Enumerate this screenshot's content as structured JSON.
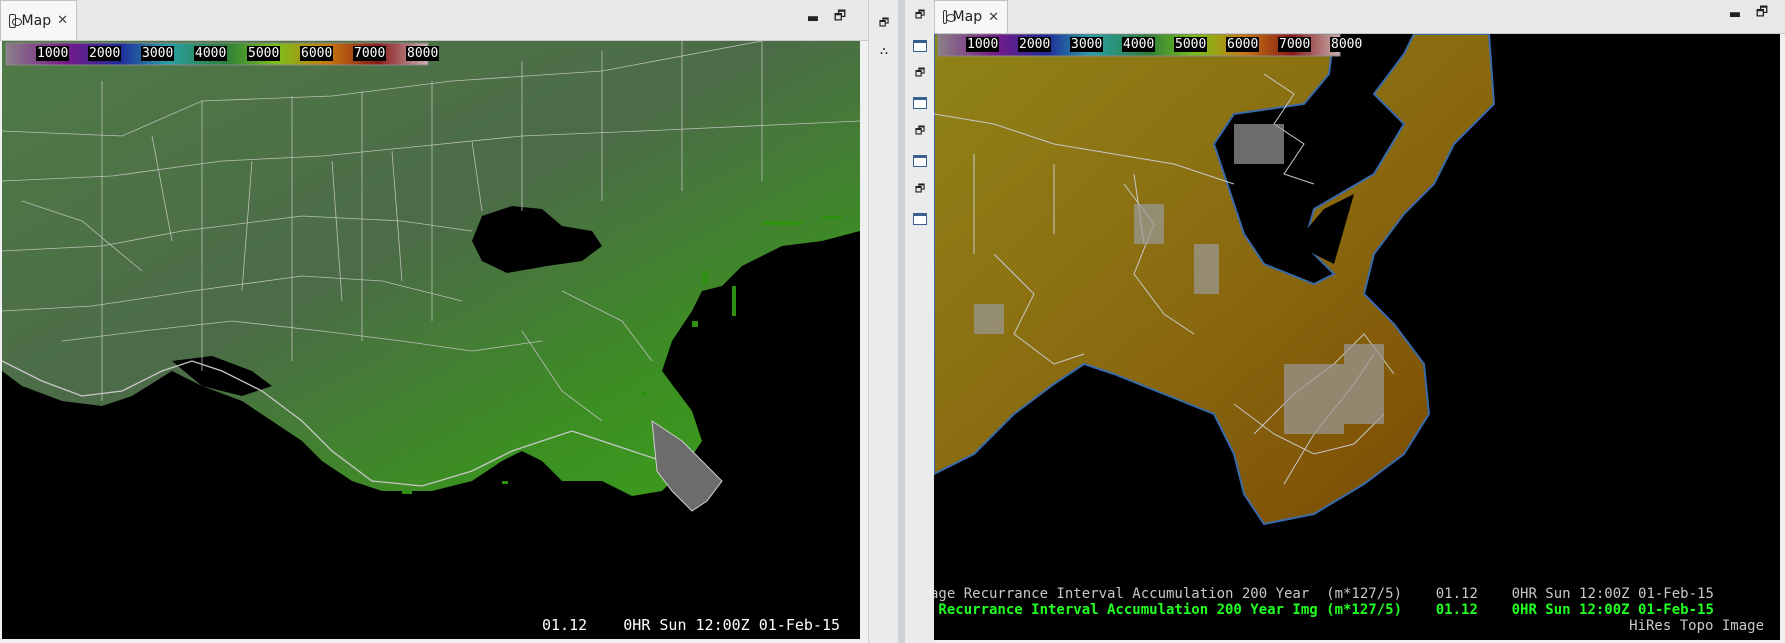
{
  "panels": {
    "left": {
      "tab_title": "Map",
      "legend": {
        "labels": [
          "1000",
          "2000",
          "3000",
          "4000",
          "5000",
          "6000",
          "7000",
          "8000"
        ]
      },
      "status_line": "01.12    0HR Sun 12:00Z 01-Feb-15"
    },
    "right": {
      "tab_title": "Map",
      "legend": {
        "labels": [
          "1000",
          "2000",
          "3000",
          "4000",
          "5000",
          "6000",
          "7000",
          "8000"
        ]
      },
      "product_lines": [
        {
          "text": "age Recurrance Interval Accumulation 200 Year  (m*127/5)    01.12    0HR Sun 12:00Z 01-Feb-15",
          "color": "#c8c8c8"
        },
        {
          "text": " Recurrance Interval Accumulation 200 Year Img (m*127/5)    01.12    0HR Sun 12:00Z 01-Feb-15",
          "color": "#22ff22"
        },
        {
          "text": "HiRes Topo Image",
          "color": "#c8c8c8"
        }
      ]
    }
  },
  "colors": {
    "left_land": "#4a6e44",
    "left_green": "#3f9a1f",
    "right_land": "#8d7a12",
    "right_dark": "#7a4b00",
    "legend_gradient": [
      "#8a7f88",
      "#7a1a8a",
      "#1f2a9a",
      "#2aa0a8",
      "#2d7f3a",
      "#7abf1a",
      "#c87a10",
      "#8a1a1a",
      "#c8b0b0"
    ]
  },
  "icons": {
    "tab": "map-window-icon",
    "close": "close-icon",
    "minimize": "minimize-icon",
    "restore": "restore-icon"
  }
}
